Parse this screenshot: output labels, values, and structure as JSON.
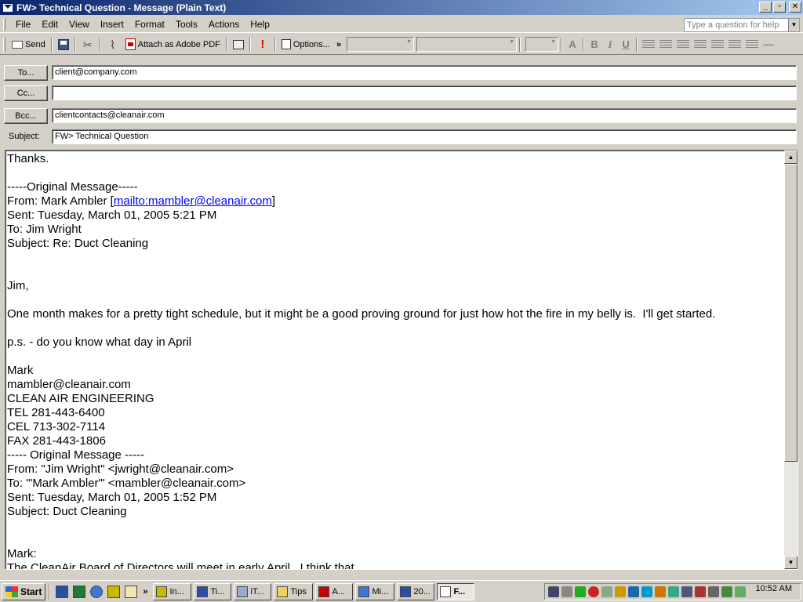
{
  "window": {
    "title": "FW> Technical Question - Message (Plain Text)",
    "controls": [
      "_",
      "▫",
      "✕"
    ]
  },
  "menu": [
    "File",
    "Edit",
    "View",
    "Insert",
    "Format",
    "Tools",
    "Actions",
    "Help"
  ],
  "help_box": {
    "placeholder": "Type a question for help"
  },
  "toolbar": {
    "send": "Send",
    "attach_pdf": "Attach as Adobe PDF",
    "options": "Options...",
    "overflow": "»"
  },
  "header": {
    "to_label": "To...",
    "to_value": "client@company.com",
    "cc_label": "Cc...",
    "cc_value": "",
    "bcc_label": "Bcc...",
    "bcc_value": "clientcontacts@cleanair.com",
    "subject_label": "Subject:",
    "subject_value": "FW> Technical Question"
  },
  "body": {
    "lines_before_link": "Thanks.\n\n-----Original Message-----\nFrom: Mark Ambler [",
    "link": "mailto:mambler@cleanair.com",
    "lines_after_link": "]\nSent: Tuesday, March 01, 2005 5:21 PM\nTo: Jim Wright\nSubject: Re: Duct Cleaning\n\n\nJim,\n\nOne month makes for a pretty tight schedule, but it might be a good proving ground for just how hot the fire in my belly is.  I'll get started.\n\np.s. - do you know what day in April\n\nMark\nmambler@cleanair.com\nCLEAN AIR ENGINEERING\nTEL 281-443-6400\nCEL 713-302-7114\nFAX 281-443-1806\n----- Original Message -----\nFrom: \"Jim Wright\" <jwright@cleanair.com>\nTo: '\"Mark Ambler\"' <mambler@cleanair.com>\nSent: Tuesday, March 01, 2005 1:52 PM\nSubject: Duct Cleaning\n\n\nMark:\nThe CleanAir Board of Directors will meet in early April.  I think that"
  },
  "taskbar": {
    "start": "Start",
    "quicklaunch_more": "»",
    "tasks": [
      "In...",
      "Ti...",
      "iT...",
      "Tips",
      "A...",
      "Mi...",
      "20...",
      "F..."
    ],
    "active_task_index": 7,
    "clock": "10:52 AM"
  }
}
